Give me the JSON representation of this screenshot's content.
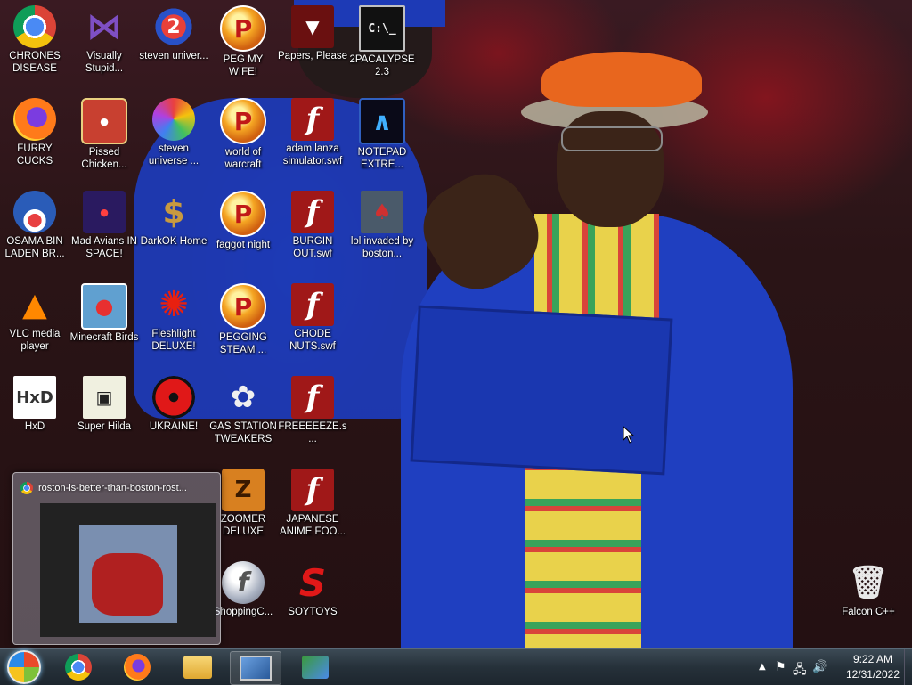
{
  "desktop_icons": [
    {
      "label": "CHRONES DISEASE",
      "icon": "chrome-icon"
    },
    {
      "label": "Visually Stupid...",
      "icon": "visual-studio-icon"
    },
    {
      "label": "steven univer...",
      "icon": "steven-universe-icon"
    },
    {
      "label": "PEG MY WIFE!",
      "icon": "p-game-icon"
    },
    {
      "label": "Papers, Please",
      "icon": "papers-please-icon"
    },
    {
      "label": "2PACALYPSE 2.3",
      "icon": "cmd-icon"
    },
    {
      "label": "FURRY CUCKS",
      "icon": "firefox-icon"
    },
    {
      "label": "Pissed Chicken...",
      "icon": "angry-birds-seasons-icon"
    },
    {
      "label": "steven universe ...",
      "icon": "gem-icon"
    },
    {
      "label": "world of warcraft",
      "icon": "p-game-icon"
    },
    {
      "label": "adam lanza simulator.swf",
      "icon": "flash-icon"
    },
    {
      "label": "NOTEPAD EXTRE...",
      "icon": "notepad-icon"
    },
    {
      "label": "OSAMA BIN LADEN BR...",
      "icon": "obama-logo-icon"
    },
    {
      "label": "Mad Avians IN SPACE!",
      "icon": "angry-birds-space-icon"
    },
    {
      "label": "DarkOK Home",
      "icon": "money-bag-icon"
    },
    {
      "label": "faggot night",
      "icon": "p-game-icon"
    },
    {
      "label": "BURGIN OUT.swf",
      "icon": "flash-icon"
    },
    {
      "label": "lol invaded by boston...",
      "icon": "image-file-icon"
    },
    {
      "label": "VLC media player",
      "icon": "vlc-icon"
    },
    {
      "label": "Minecraft Birds",
      "icon": "angry-birds-icon"
    },
    {
      "label": "Fleshlight DELUXE!",
      "icon": "red-fuzzy-icon"
    },
    {
      "label": "PEGGING STEAM ...",
      "icon": "p-game-icon"
    },
    {
      "label": "CHODE NUTS.swf",
      "icon": "flash-icon"
    },
    {
      "label": "HxD",
      "icon": "hxd-icon"
    },
    {
      "label": "Super Hilda",
      "icon": "pixel-character-icon"
    },
    {
      "label": "UKRAINE!",
      "icon": "radiation-icon"
    },
    {
      "label": "GAS STATION TWEAKERS",
      "icon": "flower-icon"
    },
    {
      "label": "FREEEEEZE.s...",
      "icon": "flash-icon"
    },
    {
      "label": "ZOOMER DELUXE",
      "icon": "zoomer-icon"
    },
    {
      "label": "JAPANESE ANIME FOO...",
      "icon": "flash-icon"
    },
    {
      "label": "ShoppingC...",
      "icon": "flash-player-icon"
    },
    {
      "label": "SOYTOYS",
      "icon": "soytoys-icon"
    },
    {
      "label": "Falcon C++",
      "icon": "recycle-bin-icon"
    }
  ],
  "thumbnail_preview": {
    "title": "roston-is-better-than-boston-rost..."
  },
  "taskbar": {
    "apps": [
      {
        "name": "start-button"
      },
      {
        "name": "chrome"
      },
      {
        "name": "firefox"
      },
      {
        "name": "file-explorer"
      },
      {
        "name": "photo-viewer"
      },
      {
        "name": "network-app"
      }
    ]
  },
  "clock": {
    "time": "9:22 AM",
    "date": "12/31/2022"
  }
}
